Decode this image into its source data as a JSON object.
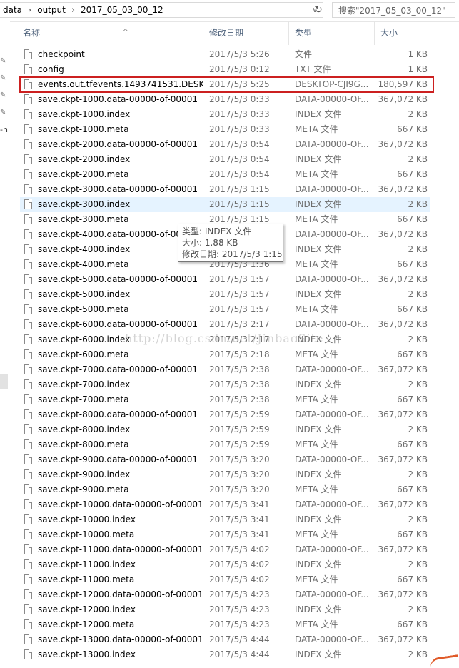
{
  "address_bar": {
    "segments": [
      "data",
      "output",
      "2017_05_03_00_12"
    ],
    "search_placeholder": "搜索\"2017_05_03_00_12\""
  },
  "nav": {
    "partial_text": "-n"
  },
  "columns": {
    "name": "名称",
    "date": "修改日期",
    "type": "类型",
    "size": "大小"
  },
  "files": [
    {
      "name": "checkpoint",
      "date": "2017/5/3 5:26",
      "type": "文件",
      "size": "1 KB"
    },
    {
      "name": "config",
      "date": "2017/5/3 0:12",
      "type": "TXT 文件",
      "size": "1 KB"
    },
    {
      "name": "events.out.tfevents.1493741531.DESK...",
      "date": "2017/5/3 5:25",
      "type": "DESKTOP-CJI9G...",
      "size": "180,597 KB"
    },
    {
      "name": "save.ckpt-1000.data-00000-of-00001",
      "date": "2017/5/3 0:33",
      "type": "DATA-00000-OF...",
      "size": "367,072 KB"
    },
    {
      "name": "save.ckpt-1000.index",
      "date": "2017/5/3 0:33",
      "type": "INDEX 文件",
      "size": "2 KB"
    },
    {
      "name": "save.ckpt-1000.meta",
      "date": "2017/5/3 0:33",
      "type": "META 文件",
      "size": "667 KB"
    },
    {
      "name": "save.ckpt-2000.data-00000-of-00001",
      "date": "2017/5/3 0:54",
      "type": "DATA-00000-OF...",
      "size": "367,072 KB"
    },
    {
      "name": "save.ckpt-2000.index",
      "date": "2017/5/3 0:54",
      "type": "INDEX 文件",
      "size": "2 KB"
    },
    {
      "name": "save.ckpt-2000.meta",
      "date": "2017/5/3 0:54",
      "type": "META 文件",
      "size": "667 KB"
    },
    {
      "name": "save.ckpt-3000.data-00000-of-00001",
      "date": "2017/5/3 1:15",
      "type": "DATA-00000-OF...",
      "size": "367,072 KB"
    },
    {
      "name": "save.ckpt-3000.index",
      "date": "2017/5/3 1:15",
      "type": "INDEX 文件",
      "size": "2 KB"
    },
    {
      "name": "save.ckpt-3000.meta",
      "date": "2017/5/3 1:15",
      "type": "META 文件",
      "size": "667 KB"
    },
    {
      "name": "save.ckpt-4000.data-00000-of-00001",
      "date": "",
      "type": "DATA-00000-OF...",
      "size": "367,072 KB"
    },
    {
      "name": "save.ckpt-4000.index",
      "date": "",
      "type": "INDEX 文件",
      "size": "2 KB"
    },
    {
      "name": "save.ckpt-4000.meta",
      "date": "2017/5/3 1:36",
      "type": "META 文件",
      "size": "667 KB"
    },
    {
      "name": "save.ckpt-5000.data-00000-of-00001",
      "date": "2017/5/3 1:57",
      "type": "DATA-00000-OF...",
      "size": "367,072 KB"
    },
    {
      "name": "save.ckpt-5000.index",
      "date": "2017/5/3 1:57",
      "type": "INDEX 文件",
      "size": "2 KB"
    },
    {
      "name": "save.ckpt-5000.meta",
      "date": "2017/5/3 1:57",
      "type": "META 文件",
      "size": "667 KB"
    },
    {
      "name": "save.ckpt-6000.data-00000-of-00001",
      "date": "2017/5/3 2:17",
      "type": "DATA-00000-OF...",
      "size": "367,072 KB"
    },
    {
      "name": "save.ckpt-6000.index",
      "date": "2017/5/3 2:17",
      "type": "INDEX 文件",
      "size": "2 KB"
    },
    {
      "name": "save.ckpt-6000.meta",
      "date": "2017/5/3 2:18",
      "type": "META 文件",
      "size": "667 KB"
    },
    {
      "name": "save.ckpt-7000.data-00000-of-00001",
      "date": "2017/5/3 2:38",
      "type": "DATA-00000-OF...",
      "size": "367,072 KB"
    },
    {
      "name": "save.ckpt-7000.index",
      "date": "2017/5/3 2:38",
      "type": "INDEX 文件",
      "size": "2 KB"
    },
    {
      "name": "save.ckpt-7000.meta",
      "date": "2017/5/3 2:38",
      "type": "META 文件",
      "size": "667 KB"
    },
    {
      "name": "save.ckpt-8000.data-00000-of-00001",
      "date": "2017/5/3 2:59",
      "type": "DATA-00000-OF...",
      "size": "367,072 KB"
    },
    {
      "name": "save.ckpt-8000.index",
      "date": "2017/5/3 2:59",
      "type": "INDEX 文件",
      "size": "2 KB"
    },
    {
      "name": "save.ckpt-8000.meta",
      "date": "2017/5/3 2:59",
      "type": "META 文件",
      "size": "667 KB"
    },
    {
      "name": "save.ckpt-9000.data-00000-of-00001",
      "date": "2017/5/3 3:20",
      "type": "DATA-00000-OF...",
      "size": "367,072 KB"
    },
    {
      "name": "save.ckpt-9000.index",
      "date": "2017/5/3 3:20",
      "type": "INDEX 文件",
      "size": "2 KB"
    },
    {
      "name": "save.ckpt-9000.meta",
      "date": "2017/5/3 3:20",
      "type": "META 文件",
      "size": "667 KB"
    },
    {
      "name": "save.ckpt-10000.data-00000-of-00001",
      "date": "2017/5/3 3:41",
      "type": "DATA-00000-OF...",
      "size": "367,072 KB"
    },
    {
      "name": "save.ckpt-10000.index",
      "date": "2017/5/3 3:41",
      "type": "INDEX 文件",
      "size": "2 KB"
    },
    {
      "name": "save.ckpt-10000.meta",
      "date": "2017/5/3 3:41",
      "type": "META 文件",
      "size": "667 KB"
    },
    {
      "name": "save.ckpt-11000.data-00000-of-00001",
      "date": "2017/5/3 4:02",
      "type": "DATA-00000-OF...",
      "size": "367,072 KB"
    },
    {
      "name": "save.ckpt-11000.index",
      "date": "2017/5/3 4:02",
      "type": "INDEX 文件",
      "size": "2 KB"
    },
    {
      "name": "save.ckpt-11000.meta",
      "date": "2017/5/3 4:02",
      "type": "META 文件",
      "size": "667 KB"
    },
    {
      "name": "save.ckpt-12000.data-00000-of-00001",
      "date": "2017/5/3 4:23",
      "type": "DATA-00000-OF...",
      "size": "367,072 KB"
    },
    {
      "name": "save.ckpt-12000.index",
      "date": "2017/5/3 4:23",
      "type": "INDEX 文件",
      "size": "2 KB"
    },
    {
      "name": "save.ckpt-12000.meta",
      "date": "2017/5/3 4:23",
      "type": "META 文件",
      "size": "667 KB"
    },
    {
      "name": "save.ckpt-13000.data-00000-of-00001",
      "date": "2017/5/3 4:44",
      "type": "DATA-00000-OF...",
      "size": "367,072 KB"
    },
    {
      "name": "save.ckpt-13000.index",
      "date": "2017/5/3 4:44",
      "type": "INDEX 文件",
      "size": "2 KB"
    }
  ],
  "highlighted_row": 2,
  "hovered_row": 10,
  "tooltip": {
    "type_line": "类型: INDEX 文件",
    "size_line": "大小: 1.88 KB",
    "date_line": "修改日期: 2017/5/3 1:15"
  },
  "watermark": "http://blog.csdn.net/JinbaoSite"
}
